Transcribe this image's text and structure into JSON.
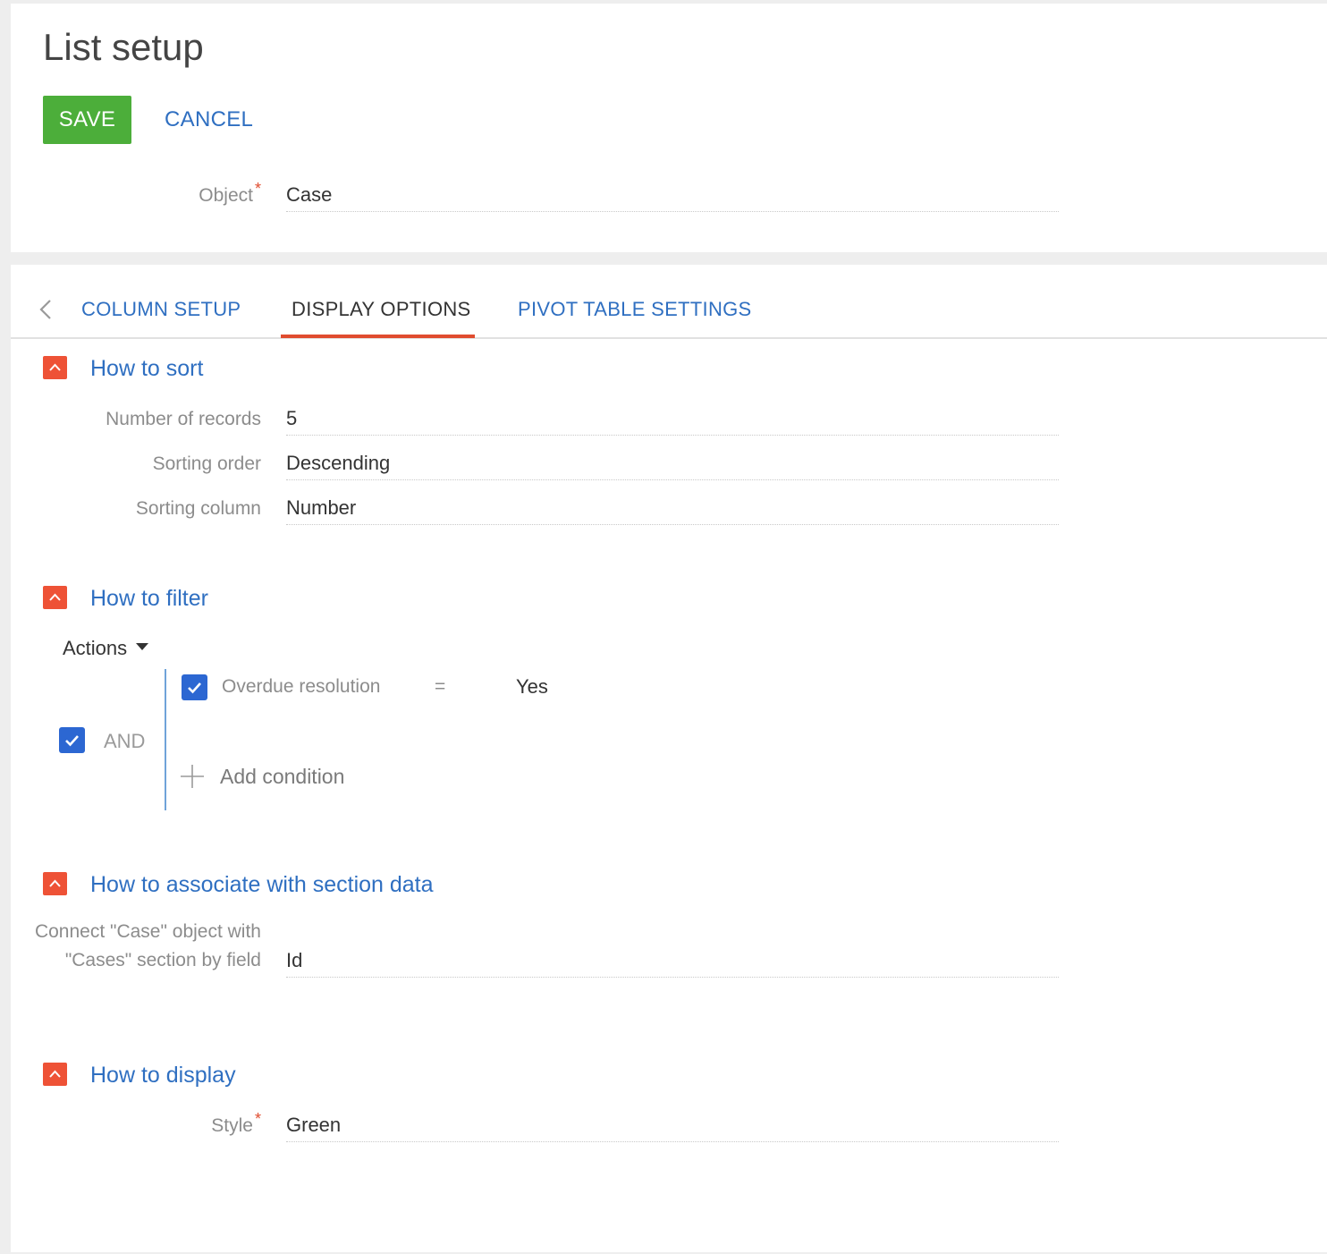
{
  "page": {
    "title": "List setup"
  },
  "toolbar": {
    "save_label": "SAVE",
    "cancel_label": "CANCEL"
  },
  "object_field": {
    "label": "Object",
    "required_mark": "*",
    "value": "Case"
  },
  "tabs": [
    {
      "label": "COLUMN SETUP",
      "active": false
    },
    {
      "label": "DISPLAY OPTIONS",
      "active": true
    },
    {
      "label": "PIVOT TABLE SETTINGS",
      "active": false
    }
  ],
  "sections": {
    "sort": {
      "title": "How to sort",
      "fields": [
        {
          "label": "Number of records",
          "value": "5"
        },
        {
          "label": "Sorting order",
          "value": "Descending"
        },
        {
          "label": "Sorting column",
          "value": "Number"
        }
      ]
    },
    "filter": {
      "title": "How to filter",
      "actions_label": "Actions",
      "group_operator": "AND",
      "group_checked": true,
      "conditions": [
        {
          "checked": true,
          "column": "Overdue resolution",
          "operator": "=",
          "value": "Yes"
        }
      ],
      "add_condition_label": "Add condition"
    },
    "associate": {
      "title": "How to associate with section data",
      "field_label": "Connect \"Case\" object with \"Cases\" section by field",
      "value": "Id"
    },
    "display": {
      "title": "How to display",
      "style_label": "Style",
      "required_mark": "*",
      "style_value": "Green"
    }
  },
  "colors": {
    "accent_blue": "#2f6fc1",
    "save_green": "#4cae3a",
    "section_toggle_red": "#ee5236",
    "checkbox_blue": "#2c67d2",
    "active_tab_underline": "#e04c2f"
  },
  "icons": {
    "tab_back": "chevron-left-icon",
    "section_toggle": "chevron-up-icon",
    "checkbox": "checkmark-icon",
    "add_condition": "plus-icon",
    "actions_menu": "caret-down-icon"
  }
}
